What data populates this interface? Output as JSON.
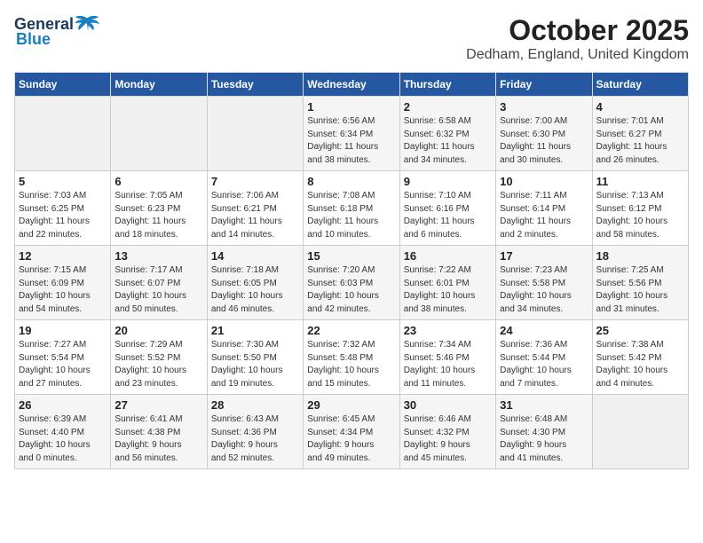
{
  "header": {
    "logo_general": "General",
    "logo_blue": "Blue",
    "title": "October 2025",
    "subtitle": "Dedham, England, United Kingdom"
  },
  "columns": [
    "Sunday",
    "Monday",
    "Tuesday",
    "Wednesday",
    "Thursday",
    "Friday",
    "Saturday"
  ],
  "weeks": [
    [
      {
        "day": "",
        "info": ""
      },
      {
        "day": "",
        "info": ""
      },
      {
        "day": "",
        "info": ""
      },
      {
        "day": "1",
        "info": "Sunrise: 6:56 AM\nSunset: 6:34 PM\nDaylight: 11 hours\nand 38 minutes."
      },
      {
        "day": "2",
        "info": "Sunrise: 6:58 AM\nSunset: 6:32 PM\nDaylight: 11 hours\nand 34 minutes."
      },
      {
        "day": "3",
        "info": "Sunrise: 7:00 AM\nSunset: 6:30 PM\nDaylight: 11 hours\nand 30 minutes."
      },
      {
        "day": "4",
        "info": "Sunrise: 7:01 AM\nSunset: 6:27 PM\nDaylight: 11 hours\nand 26 minutes."
      }
    ],
    [
      {
        "day": "5",
        "info": "Sunrise: 7:03 AM\nSunset: 6:25 PM\nDaylight: 11 hours\nand 22 minutes."
      },
      {
        "day": "6",
        "info": "Sunrise: 7:05 AM\nSunset: 6:23 PM\nDaylight: 11 hours\nand 18 minutes."
      },
      {
        "day": "7",
        "info": "Sunrise: 7:06 AM\nSunset: 6:21 PM\nDaylight: 11 hours\nand 14 minutes."
      },
      {
        "day": "8",
        "info": "Sunrise: 7:08 AM\nSunset: 6:18 PM\nDaylight: 11 hours\nand 10 minutes."
      },
      {
        "day": "9",
        "info": "Sunrise: 7:10 AM\nSunset: 6:16 PM\nDaylight: 11 hours\nand 6 minutes."
      },
      {
        "day": "10",
        "info": "Sunrise: 7:11 AM\nSunset: 6:14 PM\nDaylight: 11 hours\nand 2 minutes."
      },
      {
        "day": "11",
        "info": "Sunrise: 7:13 AM\nSunset: 6:12 PM\nDaylight: 10 hours\nand 58 minutes."
      }
    ],
    [
      {
        "day": "12",
        "info": "Sunrise: 7:15 AM\nSunset: 6:09 PM\nDaylight: 10 hours\nand 54 minutes."
      },
      {
        "day": "13",
        "info": "Sunrise: 7:17 AM\nSunset: 6:07 PM\nDaylight: 10 hours\nand 50 minutes."
      },
      {
        "day": "14",
        "info": "Sunrise: 7:18 AM\nSunset: 6:05 PM\nDaylight: 10 hours\nand 46 minutes."
      },
      {
        "day": "15",
        "info": "Sunrise: 7:20 AM\nSunset: 6:03 PM\nDaylight: 10 hours\nand 42 minutes."
      },
      {
        "day": "16",
        "info": "Sunrise: 7:22 AM\nSunset: 6:01 PM\nDaylight: 10 hours\nand 38 minutes."
      },
      {
        "day": "17",
        "info": "Sunrise: 7:23 AM\nSunset: 5:58 PM\nDaylight: 10 hours\nand 34 minutes."
      },
      {
        "day": "18",
        "info": "Sunrise: 7:25 AM\nSunset: 5:56 PM\nDaylight: 10 hours\nand 31 minutes."
      }
    ],
    [
      {
        "day": "19",
        "info": "Sunrise: 7:27 AM\nSunset: 5:54 PM\nDaylight: 10 hours\nand 27 minutes."
      },
      {
        "day": "20",
        "info": "Sunrise: 7:29 AM\nSunset: 5:52 PM\nDaylight: 10 hours\nand 23 minutes."
      },
      {
        "day": "21",
        "info": "Sunrise: 7:30 AM\nSunset: 5:50 PM\nDaylight: 10 hours\nand 19 minutes."
      },
      {
        "day": "22",
        "info": "Sunrise: 7:32 AM\nSunset: 5:48 PM\nDaylight: 10 hours\nand 15 minutes."
      },
      {
        "day": "23",
        "info": "Sunrise: 7:34 AM\nSunset: 5:46 PM\nDaylight: 10 hours\nand 11 minutes."
      },
      {
        "day": "24",
        "info": "Sunrise: 7:36 AM\nSunset: 5:44 PM\nDaylight: 10 hours\nand 7 minutes."
      },
      {
        "day": "25",
        "info": "Sunrise: 7:38 AM\nSunset: 5:42 PM\nDaylight: 10 hours\nand 4 minutes."
      }
    ],
    [
      {
        "day": "26",
        "info": "Sunrise: 6:39 AM\nSunset: 4:40 PM\nDaylight: 10 hours\nand 0 minutes."
      },
      {
        "day": "27",
        "info": "Sunrise: 6:41 AM\nSunset: 4:38 PM\nDaylight: 9 hours\nand 56 minutes."
      },
      {
        "day": "28",
        "info": "Sunrise: 6:43 AM\nSunset: 4:36 PM\nDaylight: 9 hours\nand 52 minutes."
      },
      {
        "day": "29",
        "info": "Sunrise: 6:45 AM\nSunset: 4:34 PM\nDaylight: 9 hours\nand 49 minutes."
      },
      {
        "day": "30",
        "info": "Sunrise: 6:46 AM\nSunset: 4:32 PM\nDaylight: 9 hours\nand 45 minutes."
      },
      {
        "day": "31",
        "info": "Sunrise: 6:48 AM\nSunset: 4:30 PM\nDaylight: 9 hours\nand 41 minutes."
      },
      {
        "day": "",
        "info": ""
      }
    ]
  ]
}
